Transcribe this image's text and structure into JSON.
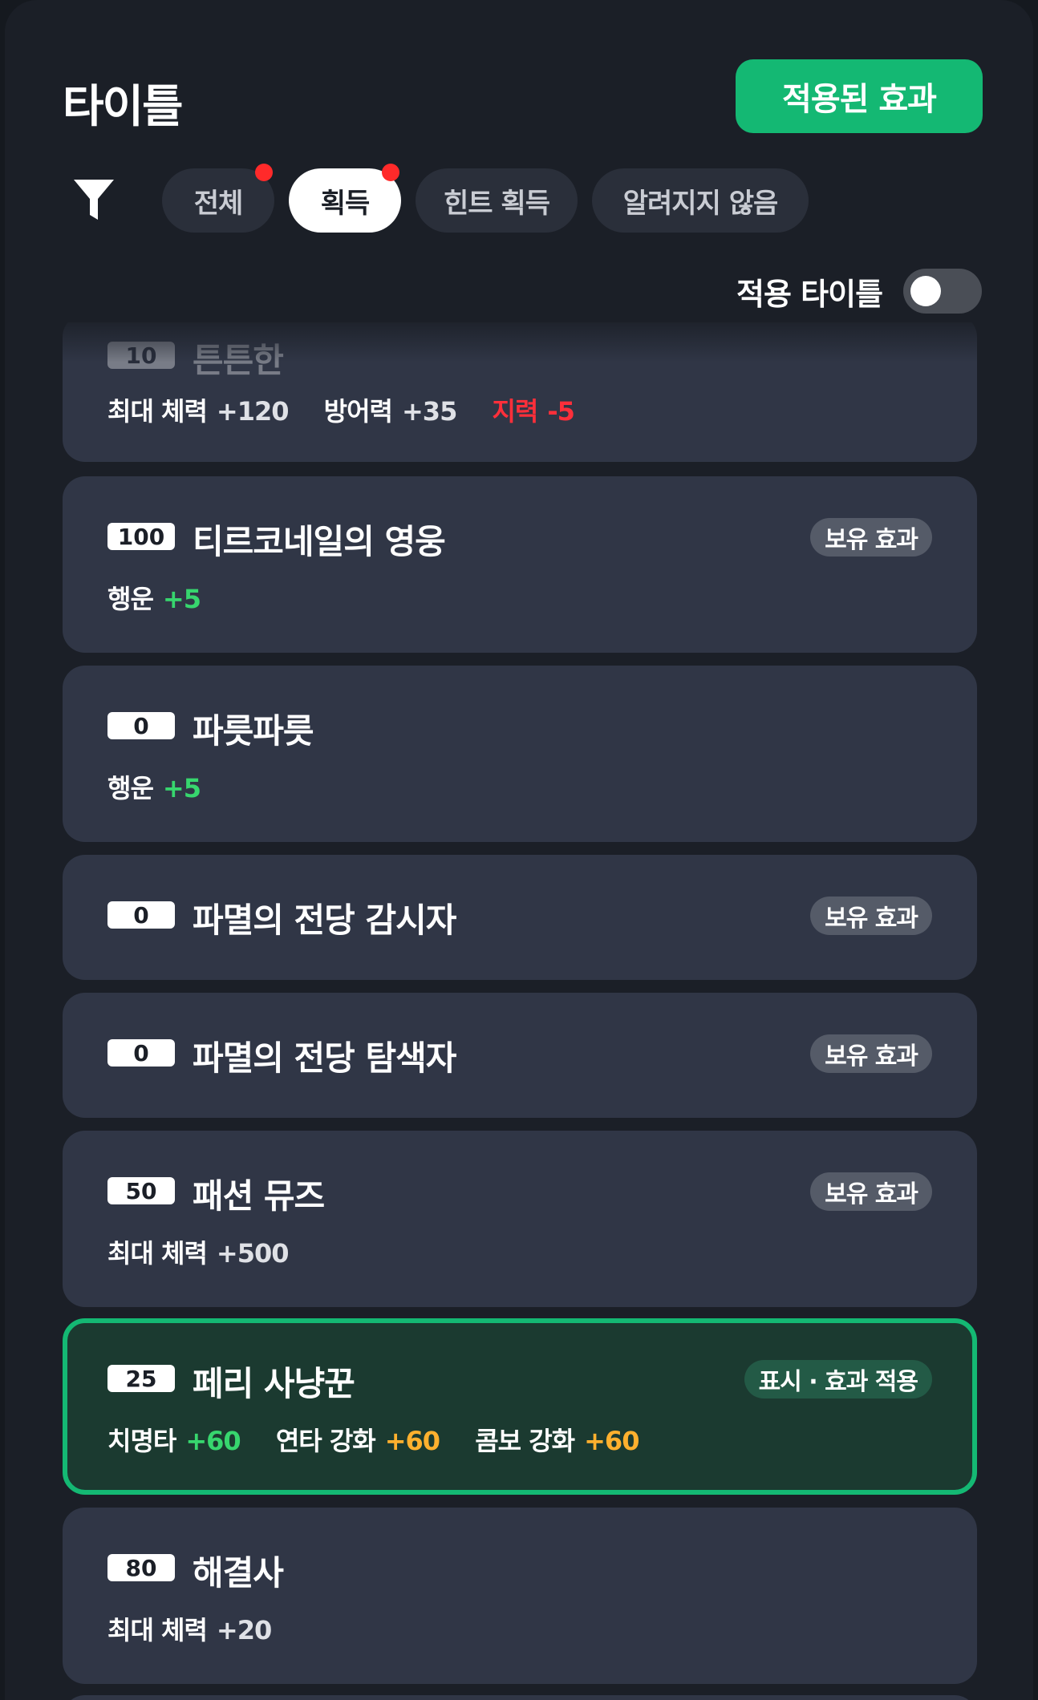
{
  "header": {
    "title": "타이틀",
    "applied_button": "적용된 효과"
  },
  "tabs": [
    {
      "label": "전체",
      "active": false,
      "dot": true
    },
    {
      "label": "획득",
      "active": true,
      "dot": true
    },
    {
      "label": "힌트 획득",
      "active": false,
      "dot": false
    },
    {
      "label": "알려지지 않음",
      "active": false,
      "dot": false
    }
  ],
  "toggle": {
    "label": "적용 타이틀",
    "on": false
  },
  "colors": {
    "accent": "#14b873",
    "stat_positive": "#37d66e",
    "stat_bonus": "#ffb02e",
    "stat_negative": "#ff2f3a",
    "card_bg": "#303646"
  },
  "titles": [
    {
      "level": "10",
      "name": "튼튼한",
      "badge": "",
      "stats": [
        {
          "label": "최대 체력",
          "value": "+120"
        },
        {
          "label": "방어력",
          "value": "+35"
        },
        {
          "label": "지력",
          "value": "-5"
        }
      ]
    },
    {
      "level": "100",
      "name": "티르코네일의 영웅",
      "badge": "보유 효과",
      "stats": [
        {
          "label": "행운",
          "value": "+5"
        }
      ]
    },
    {
      "level": "0",
      "name": "파릇파릇",
      "badge": "",
      "stats": [
        {
          "label": "행운",
          "value": "+5"
        }
      ]
    },
    {
      "level": "0",
      "name": "파멸의 전당 감시자",
      "badge": "보유 효과",
      "stats": []
    },
    {
      "level": "0",
      "name": "파멸의 전당 탐색자",
      "badge": "보유 효과",
      "stats": []
    },
    {
      "level": "50",
      "name": "패션 뮤즈",
      "badge": "보유 효과",
      "stats": [
        {
          "label": "최대 체력",
          "value": "+500"
        }
      ]
    },
    {
      "level": "25",
      "name": "페리 사냥꾼",
      "badge": "표시 · 효과 적용",
      "stats": [
        {
          "label": "치명타",
          "value": "+60"
        },
        {
          "label": "연타 강화",
          "value": "+60"
        },
        {
          "label": "콤보 강화",
          "value": "+60"
        }
      ]
    },
    {
      "level": "80",
      "name": "해결사",
      "badge": "",
      "stats": [
        {
          "label": "최대 체력",
          "value": "+20"
        }
      ]
    }
  ]
}
